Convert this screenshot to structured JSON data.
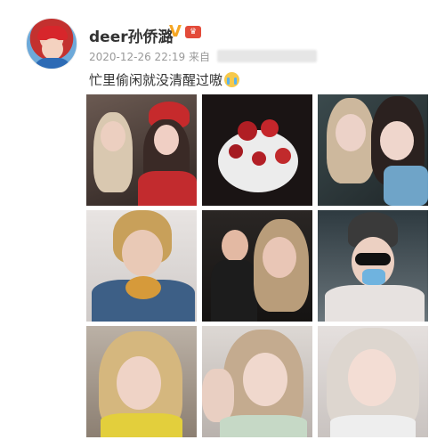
{
  "post": {
    "username": "deer孙侨潞",
    "vip_icon": "verified-v-icon",
    "level_badge_icon": "vip-level-badge-icon",
    "timestamp": "2020-12-26 22:19",
    "source_prefix": "来自",
    "text": "忙里偷闲就没清醒过嗷",
    "emoji_icon": "crying-face-emoji"
  },
  "photos": [
    "selfie-two-women-red-beret",
    "rose-bouquet",
    "closeup-two-women",
    "woman-eating-burger",
    "group-selfie-car",
    "woman-sunglasses-mask",
    "blonde-selfie-1",
    "blonde-selfie-2",
    "blonde-selfie-3"
  ],
  "colors": {
    "username": "#333333",
    "meta": "#999999",
    "vip": "#f5a623"
  }
}
